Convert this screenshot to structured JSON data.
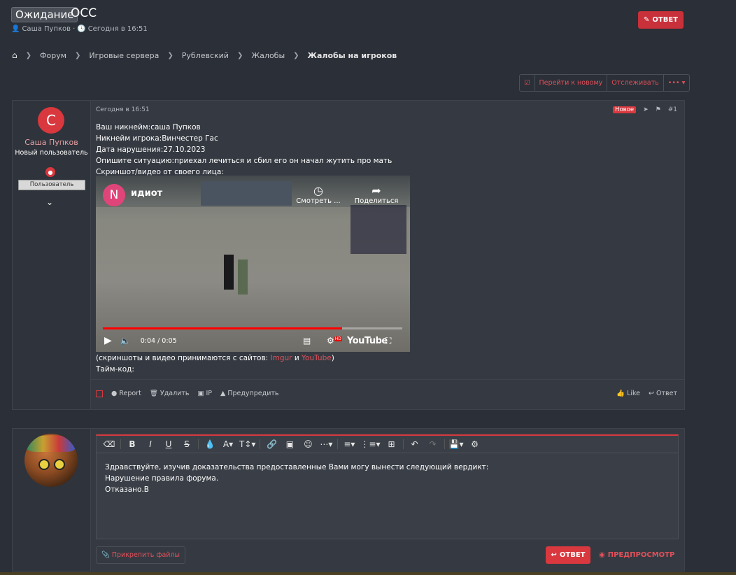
{
  "thread": {
    "prefix": "Ожидание",
    "title": "ОСС",
    "author": "Саша Пупков",
    "meta_sep": "·",
    "date": "Сегодня в 16:51",
    "reply_button": "ОТВЕТ"
  },
  "breadcrumb": [
    "Форум",
    "Игровые сервера",
    "Рублевский",
    "Жалобы",
    "Жалобы на игроков"
  ],
  "actions": {
    "go_new": "Перейти к новому",
    "watch": "Отслеживать",
    "more": "•••"
  },
  "post": {
    "date": "Сегодня в 16:51",
    "badge_new": "Новое",
    "number": "#1",
    "user": {
      "avatar_letter": "C",
      "name": "Саша Пупков",
      "title": "Новый пользователь",
      "role": "Пользователь"
    },
    "lines": [
      "Ваш никнейм:саша Пупков",
      "Никнейм игрока:Винчестер Гас",
      "Дата нарушения:27.10.2023",
      "Опишите ситуацию:приехал лечиться и сбил его он начал жутить про мать",
      "Скриншот/видео от своего лица:"
    ],
    "video": {
      "channel_letter": "N",
      "title": "идиот",
      "watch_later": "Смотреть ...",
      "share": "Поделиться",
      "time": "0:04 / 0:05",
      "progress": 0.8,
      "logo": "YouTube",
      "hd": "HD"
    },
    "note_prefix": "(скриншоты и видео принимаются с сайтов: ",
    "note_link1": "Imgur",
    "note_and": " и ",
    "note_link2": "YouTube",
    "note_suffix": ")",
    "timecode": "Тайм-код:",
    "footer": {
      "report": "Report",
      "delete": "Удалить",
      "ip": "IP",
      "warn": "Предупредить",
      "like": "Like",
      "reply": "Ответ"
    }
  },
  "reply": {
    "text": [
      "Здравствуйте, изучив доказательства предоставленные Вами могу вынести следующий вердикт:",
      "Нарушение правила форума.",
      "Отказано.В"
    ],
    "attach": "Прикрепить файлы",
    "submit": "ОТВЕТ",
    "preview": "ПРЕДПРОСМОТР"
  }
}
